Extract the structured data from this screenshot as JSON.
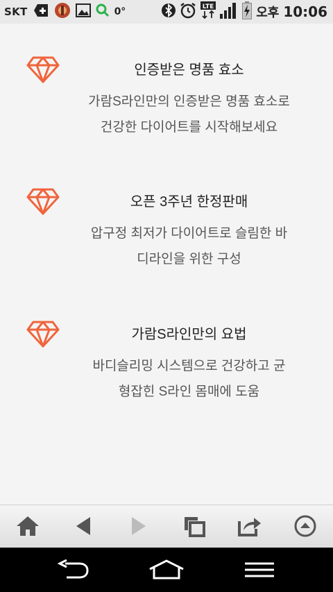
{
  "status_bar": {
    "carrier": "SKT",
    "temperature": "0°",
    "network": "LTE",
    "ampm": "오후",
    "time": "10:06",
    "icons": [
      "medical-cross-icon",
      "app-icon",
      "image-icon",
      "search-icon",
      "bluetooth-icon",
      "alarm-icon",
      "lte-icon",
      "signal-icon",
      "battery-icon"
    ]
  },
  "features": [
    {
      "icon": "diamond-icon",
      "title": "인증받은 명품 효소",
      "desc_line1": "가람S라인만의 인증받은 명품 효소로",
      "desc_line2": "건강한 다이어트를 시작해보세요"
    },
    {
      "icon": "diamond-icon",
      "title": "오픈 3주년 한정판매",
      "desc_line1": "압구정 최저가 다이어트로 슬림한 바",
      "desc_line2": "디라인을 위한 구성"
    },
    {
      "icon": "diamond-icon",
      "title": "가람S라인만의 요법",
      "desc_line1": "바디슬리밍 시스템으로 건강하고 균",
      "desc_line2": "형잡힌 S라인 몸매에 도움"
    }
  ],
  "toolbar": [
    "home-icon",
    "back-icon",
    "forward-icon",
    "windows-icon",
    "share-icon",
    "scroll-up-icon"
  ],
  "nav_bar": [
    "back-icon",
    "home-icon",
    "menu-icon"
  ],
  "colors": {
    "accent": "#f0643c",
    "toolbar_icon": "#555555",
    "toolbar_icon_disabled": "#bbbbbb"
  }
}
